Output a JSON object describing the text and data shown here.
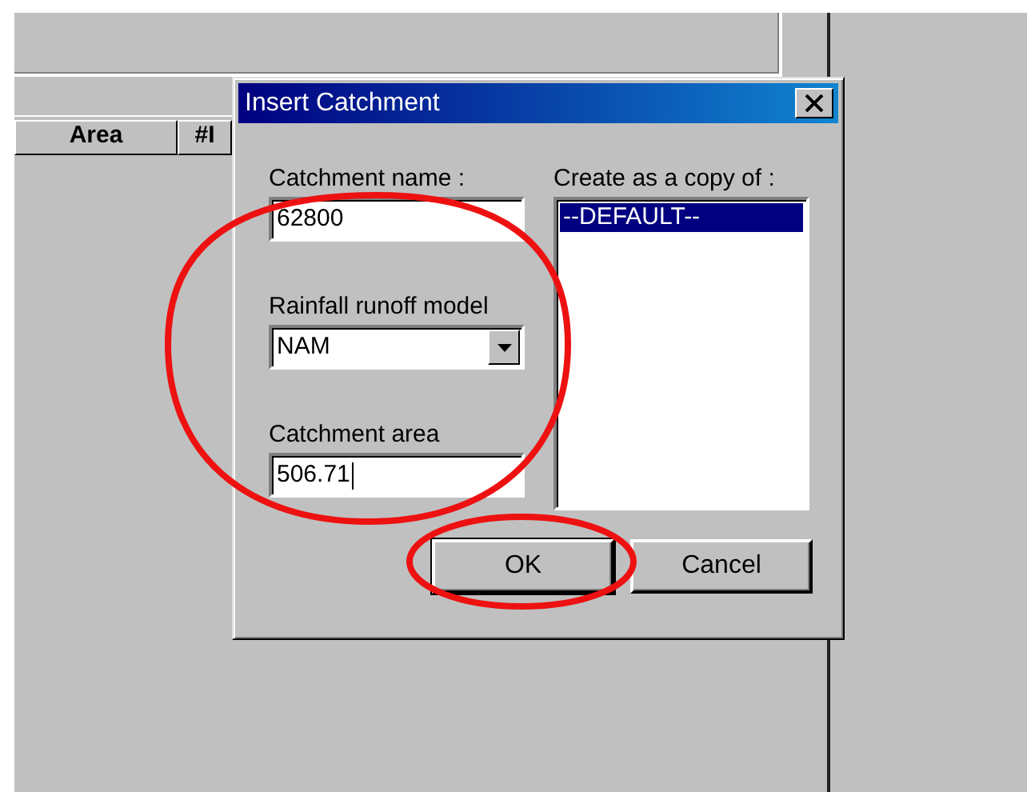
{
  "background_table": {
    "columns": [
      "Area",
      "#I"
    ]
  },
  "dialog": {
    "title": "Insert Catchment",
    "catchment_name": {
      "label": "Catchment name :",
      "value": "62800"
    },
    "rainfall_runoff_model": {
      "label": "Rainfall runoff model",
      "value": "NAM"
    },
    "catchment_area": {
      "label": "Catchment area",
      "value": "506.71",
      "focused": true
    },
    "copy_from": {
      "label": "Create as a copy of :",
      "items": [
        {
          "label": "--DEFAULT--",
          "selected": true
        }
      ]
    },
    "buttons": [
      {
        "label": "OK",
        "default": true
      },
      {
        "label": "Cancel",
        "default": false
      }
    ]
  }
}
